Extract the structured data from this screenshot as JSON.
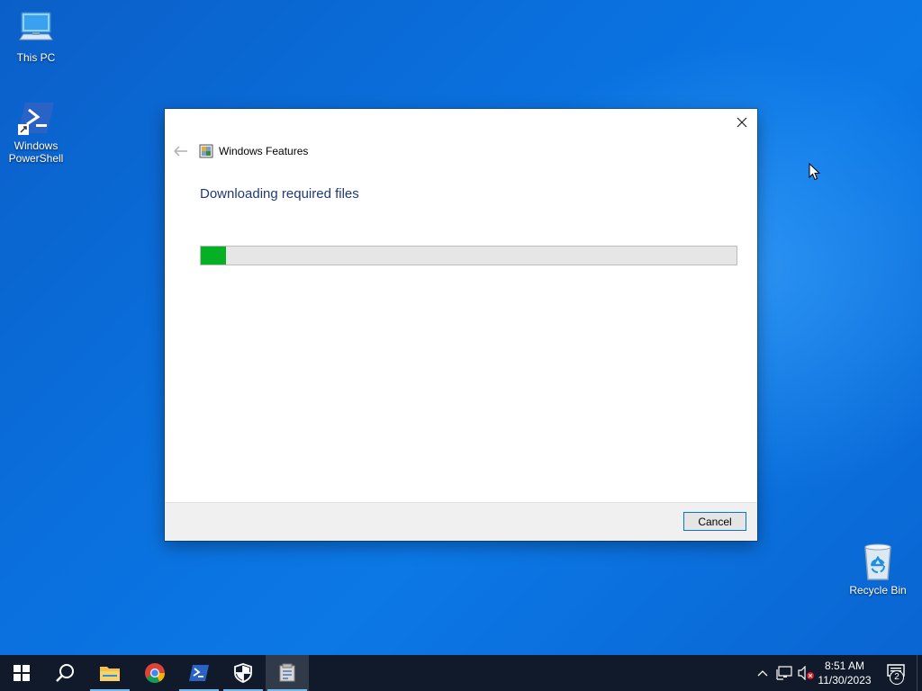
{
  "desktop": {
    "icons": [
      {
        "label": "This PC"
      },
      {
        "label": "Windows\nPowerShell"
      },
      {
        "label": "Recycle Bin"
      }
    ]
  },
  "dialog": {
    "nav_title": "Windows Features",
    "headline": "Downloading required files",
    "progress_fraction": 0.047,
    "cancel_label": "Cancel"
  },
  "taskbar": {
    "time": "8:51 AM",
    "date": "11/30/2023",
    "notification_count": "2"
  },
  "colors": {
    "progress_fill": "#06b025",
    "headline": "#1f3a78",
    "taskbar": "#101a2b"
  }
}
